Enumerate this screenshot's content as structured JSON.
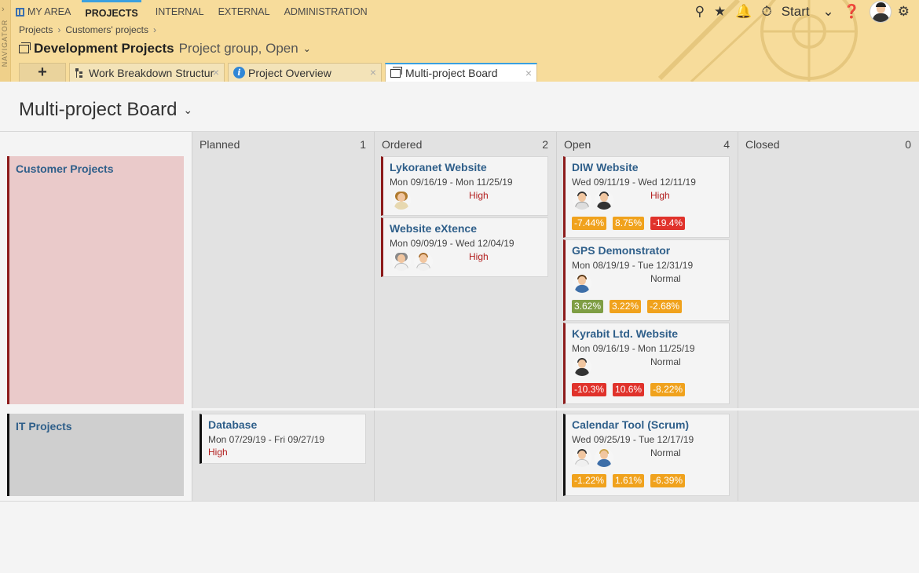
{
  "nav": {
    "strip_label": "NAVIGATOR"
  },
  "menu": [
    {
      "label": "MY AREA",
      "active": false
    },
    {
      "label": "PROJECTS",
      "active": true
    },
    {
      "label": "INTERNAL",
      "active": false
    },
    {
      "label": "EXTERNAL",
      "active": false
    },
    {
      "label": "ADMINISTRATION",
      "active": false
    }
  ],
  "toolbar": {
    "start_label": "Start"
  },
  "breadcrumb": [
    "Projects",
    "Customers' projects"
  ],
  "project": {
    "title": "Development Projects",
    "subtitle": "Project group, Open"
  },
  "tabs": [
    {
      "label": "Work Breakdown Structur"
    },
    {
      "label": "Project Overview"
    },
    {
      "label": "Multi-project Board"
    }
  ],
  "board": {
    "title": "Multi-project Board",
    "columns": [
      {
        "name": "Planned",
        "count": "1"
      },
      {
        "name": "Ordered",
        "count": "2"
      },
      {
        "name": "Open",
        "count": "4"
      },
      {
        "name": "Closed",
        "count": "0"
      }
    ],
    "lanes": [
      {
        "name": "Customer Projects",
        "color": "#8c1b1b",
        "bg": "#eacaca"
      },
      {
        "name": "IT Projects",
        "color": "#111111",
        "bg": "#cfcfcf"
      }
    ],
    "cards": {
      "lykoranet": {
        "title": "Lykoranet Website",
        "dates": "Mon 09/16/19 - Mon 11/25/19",
        "priority": "High"
      },
      "extence": {
        "title": "Website eXtence",
        "dates": "Mon 09/09/19 - Wed 12/04/19",
        "priority": "High"
      },
      "diw": {
        "title": "DIW Website",
        "dates": "Wed 09/11/19 - Wed 12/11/19",
        "priority": "High",
        "badges": [
          "-7.44%",
          "8.75%",
          "-19.4%"
        ]
      },
      "gps": {
        "title": "GPS Demonstrator",
        "dates": "Mon 08/19/19 - Tue 12/31/19",
        "priority": "Normal",
        "badges": [
          "3.62%",
          "3.22%",
          "-2.68%"
        ]
      },
      "kyrabit": {
        "title": "Kyrabit Ltd. Website",
        "dates": "Mon 09/16/19 - Mon 11/25/19",
        "priority": "Normal",
        "badges": [
          "-10.3%",
          "10.6%",
          "-8.22%"
        ]
      },
      "database": {
        "title": "Database",
        "dates": "Mon 07/29/19 - Fri 09/27/19",
        "priority": "High"
      },
      "calendar": {
        "title": "Calendar Tool (Scrum)",
        "dates": "Wed 09/25/19 - Tue 12/17/19",
        "priority": "Normal",
        "badges": [
          "-1.22%",
          "1.61%",
          "-6.39%"
        ]
      }
    }
  },
  "colors": {
    "accent": "#3aa0e0",
    "header_bg": "#f7dc9b",
    "high": "#b21f1f",
    "badge_orange": "#f0a21d",
    "badge_red": "#e0322b",
    "badge_green": "#7f9e44"
  }
}
